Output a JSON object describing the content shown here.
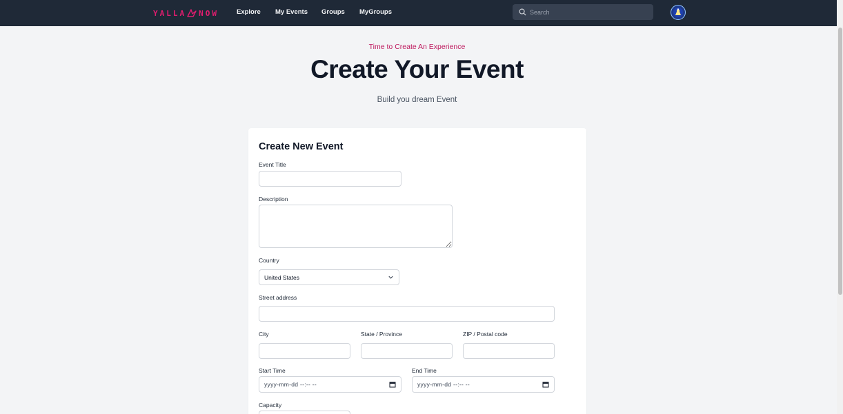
{
  "nav": {
    "logo_left": "YALLA",
    "logo_right": "NOW",
    "links": [
      "Explore",
      "My Events",
      "Groups",
      "MyGroups"
    ],
    "search_placeholder": "Search"
  },
  "hero": {
    "kicker": "Time to Create An Experience",
    "title": "Create Your Event",
    "subtitle": "Build you dream Event"
  },
  "form": {
    "title": "Create New Event",
    "event_title_label": "Event Title",
    "event_title_value": "",
    "description_label": "Description",
    "description_value": "",
    "country_label": "Country",
    "country_value": "United States",
    "street_label": "Street address",
    "street_value": "",
    "city_label": "City",
    "city_value": "",
    "state_label": "State / Province",
    "state_value": "",
    "zip_label": "ZIP / Postal code",
    "zip_value": "",
    "start_label": "Start Time",
    "start_placeholder": "yyyy-mm-dd --:-- --",
    "end_label": "End Time",
    "end_placeholder": "yyyy-mm-dd --:-- --",
    "capacity_label": "Capacity"
  },
  "colors": {
    "accent": "#e11d6f",
    "navbar": "#1f2937",
    "background": "#f3f4f6"
  },
  "icons": [
    "bird-logo-icon",
    "search-icon",
    "avatar-icon",
    "chevron-down-icon",
    "calendar-icon"
  ]
}
